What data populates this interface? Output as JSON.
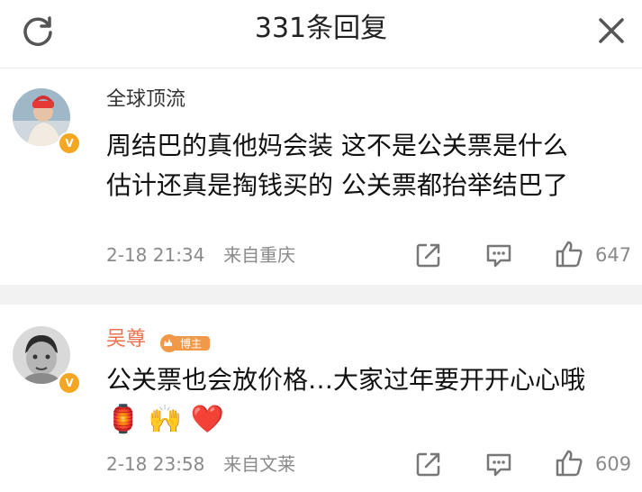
{
  "header": {
    "title": "331条回复",
    "refresh_icon": "refresh-icon",
    "close_icon": "close-icon"
  },
  "comments": [
    {
      "username": "全球顶流",
      "content_lines": [
        "周结巴的真他妈会装 这不是公关票是什么",
        "估计还真是掏钱买的 公关票都抬举结巴了"
      ],
      "time": "2-18 21:34",
      "location": "来自重庆",
      "likes": "647"
    },
    {
      "username": "吴尊",
      "badge": "博主",
      "content_lines": [
        "公关票也会放价格…大家过年要开开心心哦"
      ],
      "emojis": [
        "🏮",
        "🙌",
        "❤️"
      ],
      "time": "2-18 23:58",
      "location": "来自文莱",
      "likes": "609"
    }
  ],
  "colors": {
    "accent": "#eb7350",
    "verified": "#f5a623",
    "muted": "#8a8a8a"
  }
}
